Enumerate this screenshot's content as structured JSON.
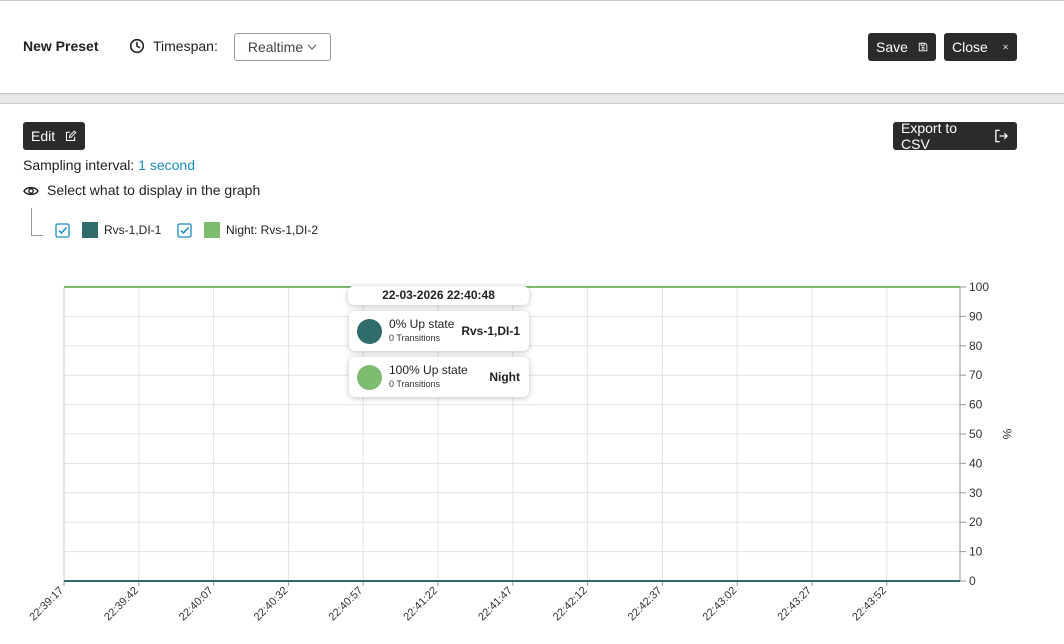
{
  "header": {
    "preset_title": "New Preset",
    "timespan_label": "Timespan:",
    "timespan_value": "Realtime",
    "save_label": "Save",
    "close_label": "Close"
  },
  "toolbar": {
    "edit_label": "Edit",
    "export_label": "Export to CSV"
  },
  "sampling": {
    "label": "Sampling interval:",
    "value": "1 second"
  },
  "display_selector": {
    "label": "Select what to display in the graph",
    "items": [
      {
        "label": "Rvs-1,DI-1",
        "checked": true,
        "color": "#2f6b6b"
      },
      {
        "label": "Night: Rvs-1,DI-2",
        "checked": true,
        "color": "#7dbb6f"
      }
    ]
  },
  "tooltip": {
    "timestamp": "22-03-2026 22:40:48",
    "rows": [
      {
        "state": "0% Up state",
        "transitions": "0 Transitions",
        "name": "Rvs-1,DI-1",
        "color": "#2f6b6b"
      },
      {
        "state": "100% Up state",
        "transitions": "0 Transitions",
        "name": "Night",
        "color": "#7dbb6f"
      }
    ]
  },
  "chart_data": {
    "type": "line",
    "x": [
      "22:39:17",
      "22:39:42",
      "22:40:07",
      "22:40:32",
      "22:40:57",
      "22:41:22",
      "22:41:47",
      "22:42:12",
      "22:42:37",
      "22:43:02",
      "22:43:27",
      "22:43:52"
    ],
    "series": [
      {
        "name": "Rvs-1,DI-1",
        "color": "#2f6b6b",
        "values": [
          0,
          0,
          0,
          0,
          0,
          0,
          0,
          0,
          0,
          0,
          0,
          0
        ]
      },
      {
        "name": "Night: Rvs-1,DI-2",
        "color": "#7dbb6f",
        "values": [
          100,
          100,
          100,
          100,
          100,
          100,
          100,
          100,
          100,
          100,
          100,
          100
        ]
      }
    ],
    "ylabel": "%",
    "ylim": [
      0,
      100
    ],
    "yticks": [
      0,
      10,
      20,
      30,
      40,
      50,
      60,
      70,
      80,
      90,
      100
    ],
    "grid": true,
    "y_axis_side": "right"
  }
}
